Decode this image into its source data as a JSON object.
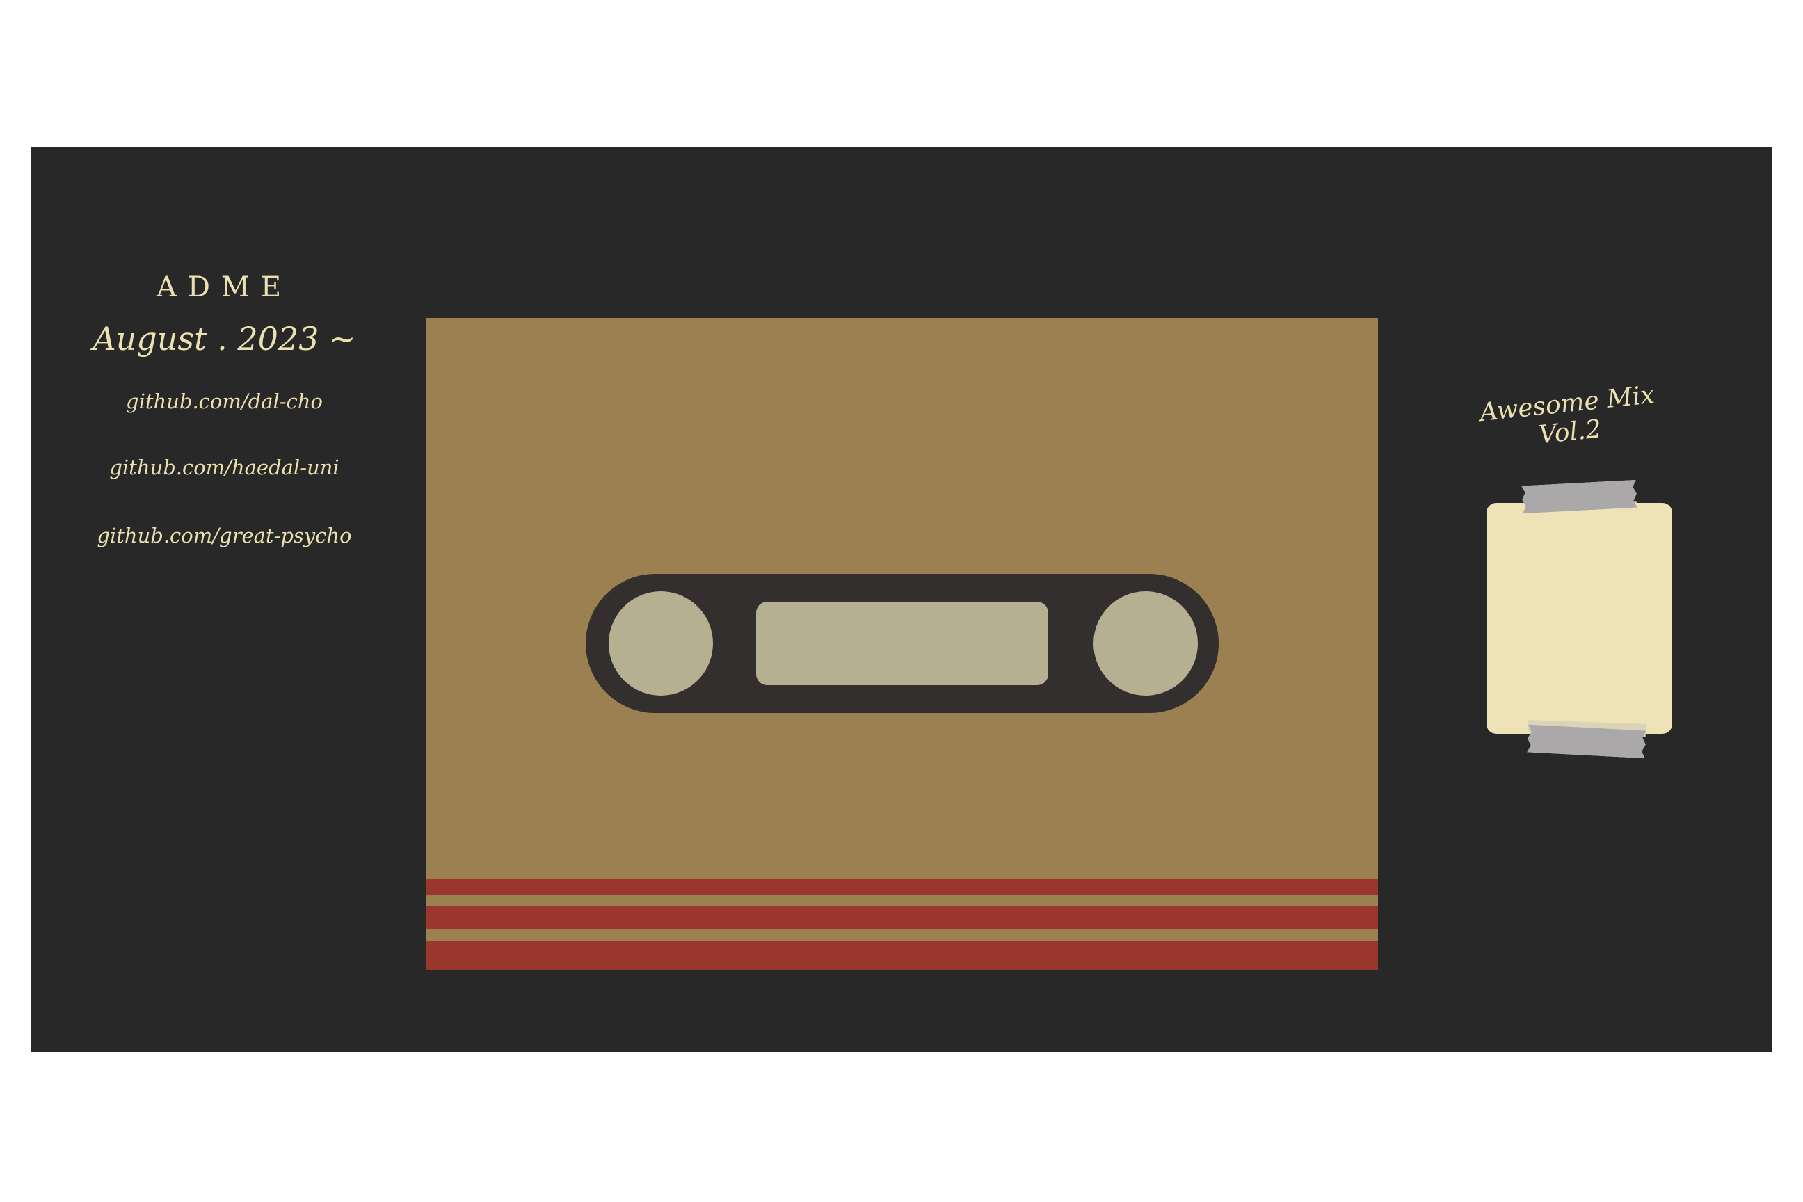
{
  "info": {
    "title": "ADME",
    "date": "August . 2023 ~",
    "links": [
      "github.com/dal-cho",
      "github.com/haedal-uni",
      "github.com/great-psycho"
    ]
  },
  "cassette": {
    "label": "Awesome Mix Vol.2"
  },
  "colors": {
    "background": "#282828",
    "text": "#ebe0b0",
    "cassette_body": "#9b8052",
    "stripe": "#9a362e",
    "window": "#342f2f",
    "reel": "#b6b092",
    "note": "#ede3b7",
    "tape": "#aaa8a8"
  }
}
